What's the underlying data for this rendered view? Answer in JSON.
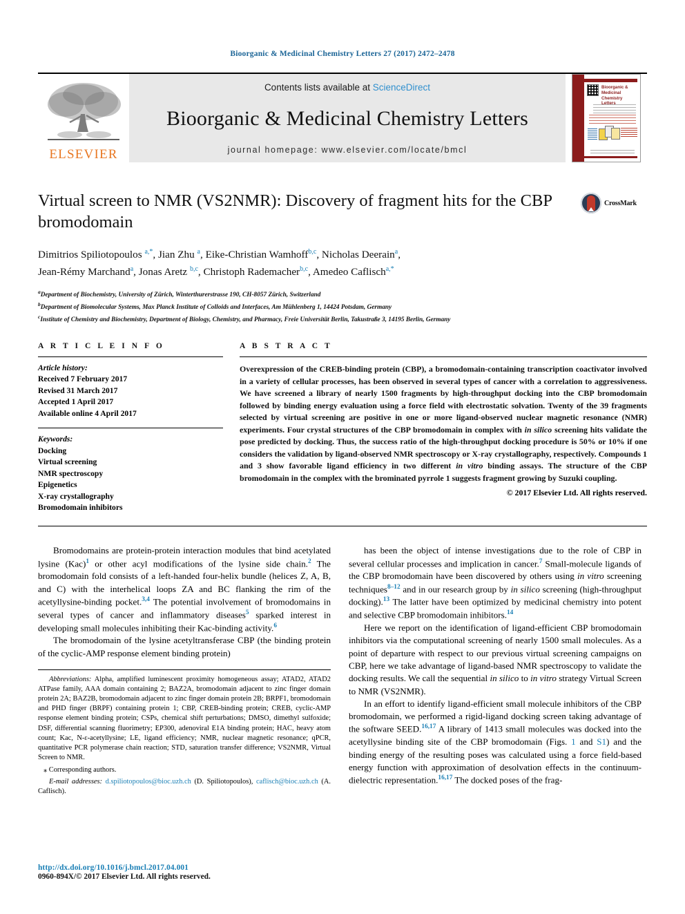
{
  "running_head": "Bioorganic & Medicinal Chemistry Letters 27 (2017) 2472–2478",
  "masthead": {
    "contents_prefix": "Contents lists available at ",
    "sciencedirect": "ScienceDirect",
    "journal_name": "Bioorganic & Medicinal Chemistry Letters",
    "homepage": "journal homepage: www.elsevier.com/locate/bmcl",
    "publisher": "ELSEVIER",
    "cover_title": "Bioorganic & Medicinal Chemistry Letters"
  },
  "article": {
    "title": "Virtual screen to NMR (VS2NMR): Discovery of fragment hits for the CBP bromodomain",
    "crossmark_label": "CrossMark",
    "authors_line1_html": "Dimitrios Spiliotopoulos <sup>a,*</sup>, Jian Zhu <sup>a</sup>, Eike-Christian Wamhoff<sup>b,c</sup>, Nicholas Deerain<sup>a</sup>,",
    "authors_line2_html": "Jean-Rémy Marchand<sup>a</sup>, Jonas Aretz <sup>b,c</sup>, Christoph Rademacher<sup>b,c</sup>, Amedeo Caflisch<sup>a,*</sup>",
    "affiliations": [
      {
        "mark": "a",
        "text": "Department of Biochemistry, University of Zürich, Winterthurerstrasse 190, CH-8057 Zürich, Switzerland"
      },
      {
        "mark": "b",
        "text": "Department of Biomolecular Systems, Max Planck Institute of Colloids and Interfaces, Am Mühlenberg 1, 14424 Potsdam, Germany"
      },
      {
        "mark": "c",
        "text": "Institute of Chemistry and Biochemistry, Department of Biology, Chemistry, and Pharmacy, Freie Universität Berlin, Takustraße 3, 14195 Berlin, Germany"
      }
    ]
  },
  "article_info": {
    "heading": "A R T I C L E   I N F O",
    "history_label": "Article history:",
    "history": [
      "Received 7 February 2017",
      "Revised 31 March 2017",
      "Accepted 1 April 2017",
      "Available online 4 April 2017"
    ],
    "keywords_label": "Keywords:",
    "keywords": [
      "Docking",
      "Virtual screening",
      "NMR spectroscopy",
      "Epigenetics",
      "X-ray crystallography",
      "Bromodomain inhibitors"
    ]
  },
  "abstract": {
    "heading": "A B S T R A C T",
    "text_html": "Overexpression of the CREB-binding protein (CBP), a bromodomain-containing transcription coactivator involved in a variety of cellular processes, has been observed in several types of cancer with a correlation to aggressiveness. We have screened a library of nearly 1500 fragments by high-throughput docking into the CBP bromodomain followed by binding energy evaluation using a force field with electrostatic solvation. Twenty of the 39 fragments selected by virtual screening are positive in one or more ligand-observed nuclear magnetic resonance (NMR) experiments. Four crystal structures of the CBP bromodomain in complex with <em>in silico</em> screening hits validate the pose predicted by docking. Thus, the success ratio of the high-throughput docking procedure is 50% or 10% if one considers the validation by ligand-observed NMR spectroscopy or X-ray crystallography, respectively. Compounds <b>1</b> and <b>3</b> show favorable ligand efficiency in two different <em>in vitro</em> binding assays. The structure of the CBP bromodomain in the complex with the brominated pyrrole <b>1</b> suggests fragment growing by Suzuki coupling.",
    "copyright": "© 2017 Elsevier Ltd. All rights reserved."
  },
  "body": {
    "left_paragraphs_html": [
      "Bromodomains are protein-protein interaction modules that bind acetylated lysine (Kac)<sup class=\"ref\">1</sup> or other acyl modifications of the lysine side chain.<sup class=\"ref\">2</sup> The bromodomain fold consists of a left-handed four-helix bundle (helices Z, A, B, and C) with the interhelical loops ZA and BC flanking the rim of the acetyllysine-binding pocket.<sup class=\"ref\">3,4</sup> The potential involvement of bromodomains in several types of cancer and inflammatory diseases<sup class=\"ref\">5</sup> sparked interest in developing small molecules inhibiting their Kac-binding activity.<sup class=\"ref\">6</sup>",
      "The bromodomain of the lysine acetyltransferase CBP (the binding protein of the cyclic-AMP response element binding protein)"
    ],
    "right_paragraphs_html": [
      "has been the object of intense investigations due to the role of CBP in several cellular processes and implication in cancer.<sup class=\"ref\">7</sup> Small-molecule ligands of the CBP bromodomain have been discovered by others using <em>in vitro</em> screening techniques<sup class=\"ref\">8–12</sup> and in our research group by <em>in silico</em> screening (high-throughput docking).<sup class=\"ref\">13</sup> The latter have been optimized by medicinal chemistry into potent and selective CBP bromodomain inhibitors.<sup class=\"ref\">14</sup>",
      "Here we report on the identification of ligand-efficient CBP bromodomain inhibitors via the computational screening of nearly 1500 small molecules. As a point of departure with respect to our previous virtual screening campaigns on CBP, here we take advantage of ligand-based NMR spectroscopy to validate the docking results. We call the sequential <em>in silico</em> to <em>in vitro</em> strategy Virtual Screen to NMR (VS2NMR).",
      "In an effort to identify ligand-efficient small molecule inhibitors of the CBP bromodomain, we performed a rigid-ligand docking screen taking advantage of the software SEED.<sup class=\"ref\">16,17</sup> A library of 1413 small molecules was docked into the acetyllysine binding site of the CBP bromodomain (Figs. <span class=\"lnk\">1</span> and <span class=\"lnk\">S1</span>) and the binding energy of the resulting poses was calculated using a force field-based energy function with approximation of desolvation effects in the continuum-dielectric representation.<sup class=\"ref\">16,17</sup> The docked poses of the frag-"
    ]
  },
  "footnotes": {
    "abbreviations_html": "<span class=\"it\">Abbreviations:</span> Alpha, amplified luminescent proximity homogeneous assay; ATAD2, ATAD2 ATPase family, AAA domain containing 2; BAZ2A, bromodomain adjacent to zinc finger domain protein 2A; BAZ2B, bromodomain adjacent to zinc finger domain protein 2B; BRPF1, bromodomain and PHD finger (BRPF) containing protein 1; CBP, CREB-binding protein; CREB, cyclic-AMP response element binding protein; CSPs, chemical shift perturbations; DMSO, dimethyl sulfoxide; DSF, differential scanning fluorimetry; EP300, adenoviral E1A binding protein; HAC, heavy atom count; Kac, N-ε-acetyllysine; LE, ligand efficiency; NMR, nuclear magnetic resonance; qPCR, quantitative PCR polymerase chain reaction; STD, saturation transfer difference; VS2NMR, Virtual Screen to NMR.",
    "corresponding": "⁎ Corresponding authors.",
    "email_html": "<span class=\"it\">E-mail addresses:</span> <span class=\"email-link\">d.spiliotopoulos@bioc.uzh.ch</span> (D. Spiliotopoulos), <span class=\"email-link\">caflisch@bioc.uzh.ch</span> (A. Caflisch)."
  },
  "page_footer": {
    "doi": "http://dx.doi.org/10.1016/j.bmcl.2017.04.001",
    "issn": "0960-894X/© 2017 Elsevier Ltd. All rights reserved."
  }
}
